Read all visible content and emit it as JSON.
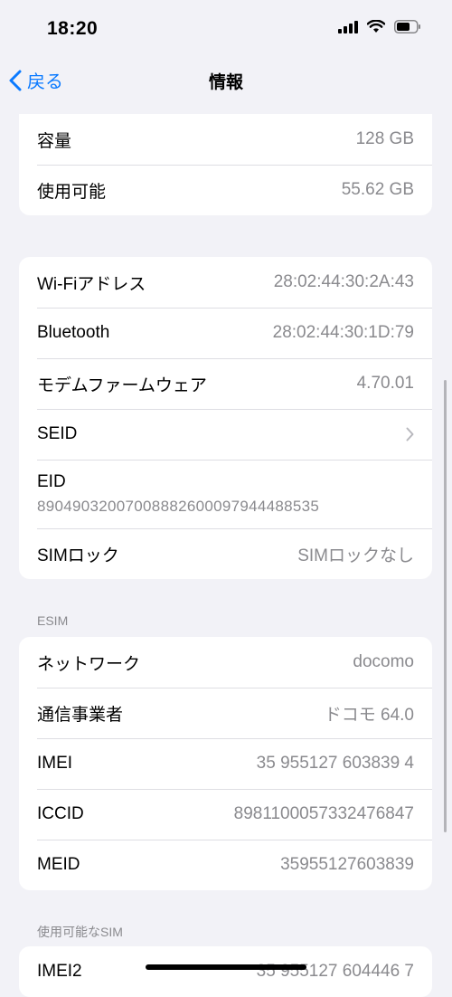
{
  "status": {
    "time": "18:20"
  },
  "nav": {
    "back_label": "戻る",
    "title": "情報"
  },
  "storage": [
    {
      "label": "容量",
      "value": "128 GB"
    },
    {
      "label": "使用可能",
      "value": "55.62 GB"
    }
  ],
  "hardware": {
    "wifi": {
      "label": "Wi-Fiアドレス",
      "value": "28:02:44:30:2A:43"
    },
    "bluetooth": {
      "label": "Bluetooth",
      "value": "28:02:44:30:1D:79"
    },
    "modem": {
      "label": "モデムファームウェア",
      "value": "4.70.01"
    },
    "seid": {
      "label": "SEID"
    },
    "eid": {
      "label": "EID",
      "value": "89049032007008882600097944488535"
    },
    "simlock": {
      "label": "SIMロック",
      "value": "SIMロックなし"
    }
  },
  "esim": {
    "header": "ESIM",
    "rows": [
      {
        "label": "ネットワーク",
        "value": "docomo"
      },
      {
        "label": "通信事業者",
        "value": "ドコモ 64.0"
      },
      {
        "label": "IMEI",
        "value": "35 955127 603839 4"
      },
      {
        "label": "ICCID",
        "value": "8981100057332476847"
      },
      {
        "label": "MEID",
        "value": "35955127603839"
      }
    ]
  },
  "available_sim": {
    "header": "使用可能なSIM",
    "rows": [
      {
        "label": "IMEI2",
        "value": "35 955127 604446 7"
      }
    ]
  }
}
